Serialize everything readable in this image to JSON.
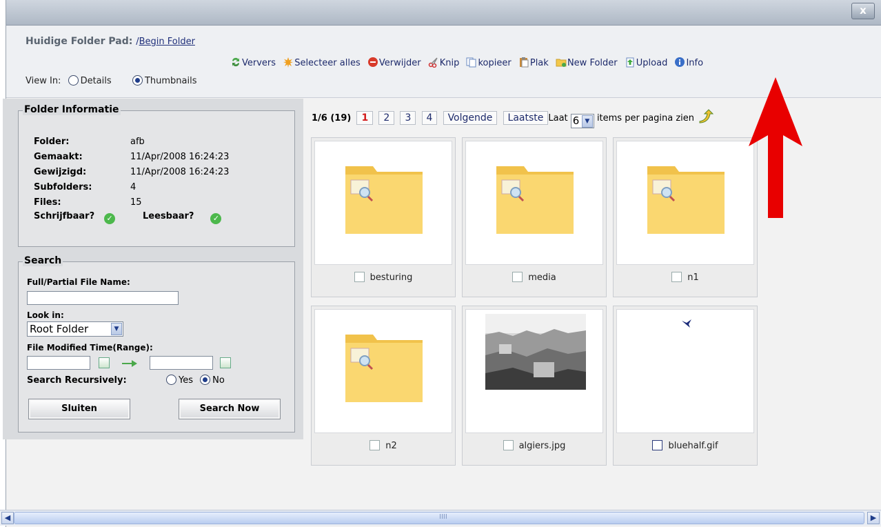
{
  "window": {
    "close_label": "x"
  },
  "path": {
    "label": "Huidige Folder Pad:",
    "slash": "/",
    "link": "Begin Folder"
  },
  "view": {
    "label": "View In:",
    "options": [
      "Details",
      "Thumbnails"
    ],
    "selected": "Thumbnails"
  },
  "toolbar": {
    "items": [
      {
        "label": "Ververs",
        "icon": "refresh-icon"
      },
      {
        "label": "Selecteer alles",
        "icon": "select-all-icon"
      },
      {
        "label": "Verwijder",
        "icon": "delete-icon"
      },
      {
        "label": "Knip",
        "icon": "scissors-icon"
      },
      {
        "label": "kopieer",
        "icon": "copy-icon"
      },
      {
        "label": "Plak",
        "icon": "paste-icon"
      },
      {
        "label": "New Folder",
        "icon": "new-folder-icon"
      },
      {
        "label": "Upload",
        "icon": "upload-icon"
      },
      {
        "label": "Info",
        "icon": "info-icon"
      }
    ]
  },
  "folder_info": {
    "title": "Folder Informatie",
    "rows": [
      {
        "key": "Folder:",
        "value": "afb"
      },
      {
        "key": "Gemaakt:",
        "value": "11/Apr/2008 16:24:23"
      },
      {
        "key": "Gewijzigd:",
        "value": "11/Apr/2008 16:24:23"
      },
      {
        "key": "Subfolders:",
        "value": "4"
      },
      {
        "key": "Files:",
        "value": "15"
      }
    ],
    "writable_label": "Schrijfbaar?",
    "readable_label": "Leesbaar?"
  },
  "search": {
    "title": "Search",
    "name_label": "Full/Partial File Name:",
    "name_value": "",
    "look_in_label": "Look in:",
    "look_in_value": "Root Folder",
    "modified_label": "File Modified Time(Range):",
    "recursive_label": "Search Recursively:",
    "recursive_options": [
      "Yes",
      "No"
    ],
    "recursive_selected": "No",
    "close_button": "Sluiten",
    "search_button": "Search Now"
  },
  "pager": {
    "status": "1/6 (19)",
    "pages": [
      "1",
      "2",
      "3",
      "4"
    ],
    "current": "1",
    "next": "Volgende",
    "last": "Laatste",
    "show_label": "Laat",
    "per_page": "6",
    "per_page_suffix": "items per pagina zien"
  },
  "items": [
    {
      "name": "besturing",
      "type": "folder"
    },
    {
      "name": "media",
      "type": "folder"
    },
    {
      "name": "n1",
      "type": "folder"
    },
    {
      "name": "n2",
      "type": "folder"
    },
    {
      "name": "algiers.jpg",
      "type": "image"
    },
    {
      "name": "bluehalf.gif",
      "type": "image"
    }
  ],
  "scrollbar": {
    "grip": "IIII"
  }
}
